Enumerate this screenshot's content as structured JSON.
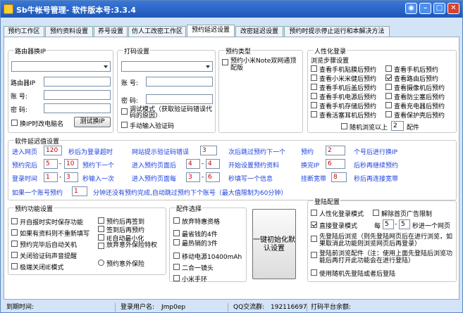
{
  "title": "Sb牛帐号管理-  软件版本号:3.3.4",
  "tabs": [
    "预约工作区",
    "预约资料设置",
    "养号设置",
    "仿人工改密工作区",
    "预约延迟设置",
    "改密延迟设置",
    "预约时提示停止运行和本解决方法"
  ],
  "router": {
    "title": "路由器换IP",
    "ip_label": "路由器IP",
    "acct_label": "账  号:",
    "pwd_label": "密  码:",
    "rename_label": "换IP时改电脑名",
    "test_button": "测试换IP"
  },
  "captcha": {
    "title": "打码设置",
    "acct_label": "账  号:",
    "pwd_label": "密  码:",
    "debug_label": "调试模式（获取验证码错误代码的原因）",
    "manual_label": "手动输入验证码"
  },
  "booking_type": {
    "title": "预约类型",
    "item": "预约小米Note双网通顶配版"
  },
  "human": {
    "title": "人性化登录",
    "sub": "浏览步骤设置",
    "items": [
      "查看手机贴膜后预约",
      "查看手机后预约",
      "查看小米米健后预约",
      "查看路由后预约",
      "查看手机后盖后预约",
      "查看摄像机后预约",
      "查看手机电源后预约",
      "查看防尘塞后预约",
      "查看手机存储后预约",
      "查看充电器后预约",
      "查看活塞耳机后预约",
      "查看保护壳后预约"
    ],
    "random_label": "随机浏览以上",
    "random_value": "2",
    "random_unit": "配件"
  },
  "delay": {
    "title": "软件延迟值设置",
    "r1": {
      "a": "进入网页",
      "v": "120",
      "b": "秒后为登录超时",
      "c": "网站提示验证码错误",
      "v2": "3",
      "d": "次后跳过预约下一个",
      "e": "预约",
      "v3": "2",
      "f": "个号后进行换IP"
    },
    "r2": {
      "a": "预约完后",
      "v1": "5",
      "v2": "10",
      "b": "预约下一个",
      "c": "进入预约页面后",
      "v3": "4",
      "v4": "4",
      "d": "开始设置预约资料",
      "e": "换完IP",
      "v5": "6",
      "f": "后秒再继续预约"
    },
    "r3": {
      "a": "登录时间",
      "v1": "1",
      "v2": "3",
      "b": "秒输入一次",
      "c": "进入预约页面每",
      "v3": "3",
      "v4": "6",
      "d": "秒填写一个信息",
      "e": "挂断宽带",
      "v5": "8",
      "f": "秒后再连接宽带"
    },
    "r4": {
      "a": "如果一个账号预约",
      "v": "1",
      "b": "分钟还没有预约完成,自动跳过预约下个账号（最大值限制为60分钟）"
    }
  },
  "func": {
    "title": "预约功能设置",
    "items": [
      "开自报时实时保存功能",
      "如果有资料则不重新填写",
      "预约完毕后自动关机",
      "关闭验证码声音提醒",
      "极端关闭IE模式"
    ],
    "right": [
      "预约后再签到",
      "签到后再预约",
      "IE自动最小化",
      "放弃意外保险特权",
      "预约意外保险"
    ]
  },
  "parts": {
    "title": "配件选择",
    "items": [
      "放弃特惠资格",
      "最省钱的4件",
      "最热销的3件",
      "移动电源10400mAh",
      "二合一镜头",
      "小米手环"
    ]
  },
  "init_button": "一键初始化默认设置",
  "login": {
    "title": "登陆配置",
    "humanize": "人性化登录模式",
    "cancel_ad": "解除首页广告限制",
    "direct": "直接登录模式",
    "every": "每",
    "v1": "5",
    "v2": "5",
    "suffix": "秒进一个网页",
    "desc1": "先登陆后浏览（则先登陆网页后在进行浏览，如果取消此功能则浏览网页后再登录）",
    "desc2": "登陆前浏览配件（注：使用上面先登陆后浏览功能后再打开此功能会在进行登陆）",
    "random": "使用随机先登陆或者后登陆"
  },
  "status": {
    "expire": "到期时间:",
    "user_label": "登录用户名:",
    "user": "Jmp0ep",
    "qq_label": "QQ交流群:",
    "qq": "192116697",
    "balance": "打码平台余额:"
  }
}
